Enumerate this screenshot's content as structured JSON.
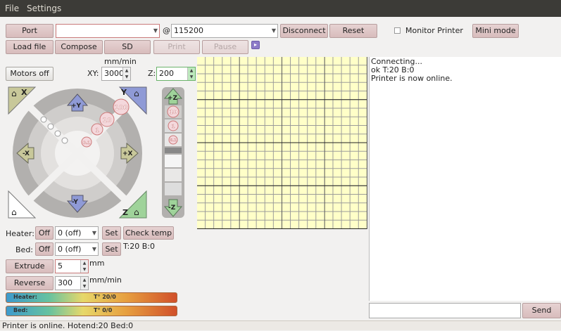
{
  "menu": {
    "file": "File",
    "settings": "Settings"
  },
  "toolbar1": {
    "port_label": "Port",
    "port_value": "",
    "at": "@",
    "baud_value": "115200",
    "disconnect_label": "Disconnect",
    "reset_label": "Reset",
    "monitor_label": "Monitor Printer",
    "mini_label": "Mini mode"
  },
  "toolbar2": {
    "load_label": "Load file",
    "compose_label": "Compose",
    "sd_label": "SD",
    "print_label": "Print",
    "pause_label": "Pause"
  },
  "motion": {
    "motors_off_label": "Motors off",
    "units_label": "mm/min",
    "xy_label": "XY:",
    "xy_value": "3000",
    "z_label": "Z:",
    "z_value": "200",
    "steps": [
      "100",
      "10",
      "1",
      "0.1"
    ],
    "axis_x_home": "X",
    "axis_y_home": "Y",
    "axis_z_home": "Z",
    "plus_x": "+X",
    "minus_x": "-X",
    "plus_y": "+Y",
    "minus_y": "-Y",
    "plus_z": "+Z",
    "minus_z": "-Z"
  },
  "temps": {
    "heater_label": "Heater:",
    "bed_label": "Bed:",
    "off_label": "Off",
    "heater_value": "0 (off)",
    "bed_value": "0 (off)",
    "set_label": "Set",
    "check_temp_label": "Check temp",
    "temp_readout": "T:20 B:0"
  },
  "extrude": {
    "extrude_label": "Extrude",
    "extrude_value": "5",
    "extrude_unit": "mm",
    "reverse_label": "Reverse",
    "reverse_value": "300",
    "reverse_unit": "mm/min"
  },
  "gauges": {
    "heater_name": "Heater:",
    "heater_reading": "T° 20/0",
    "bed_name": "Bed:",
    "bed_reading": "T° 0/0"
  },
  "log": {
    "lines": "Connecting...\nok T:20 B:0\nPrinter is now online."
  },
  "command": {
    "value": "",
    "send_label": "Send"
  },
  "status": {
    "text": "Printer is online. Hotend:20 Bed:0"
  }
}
